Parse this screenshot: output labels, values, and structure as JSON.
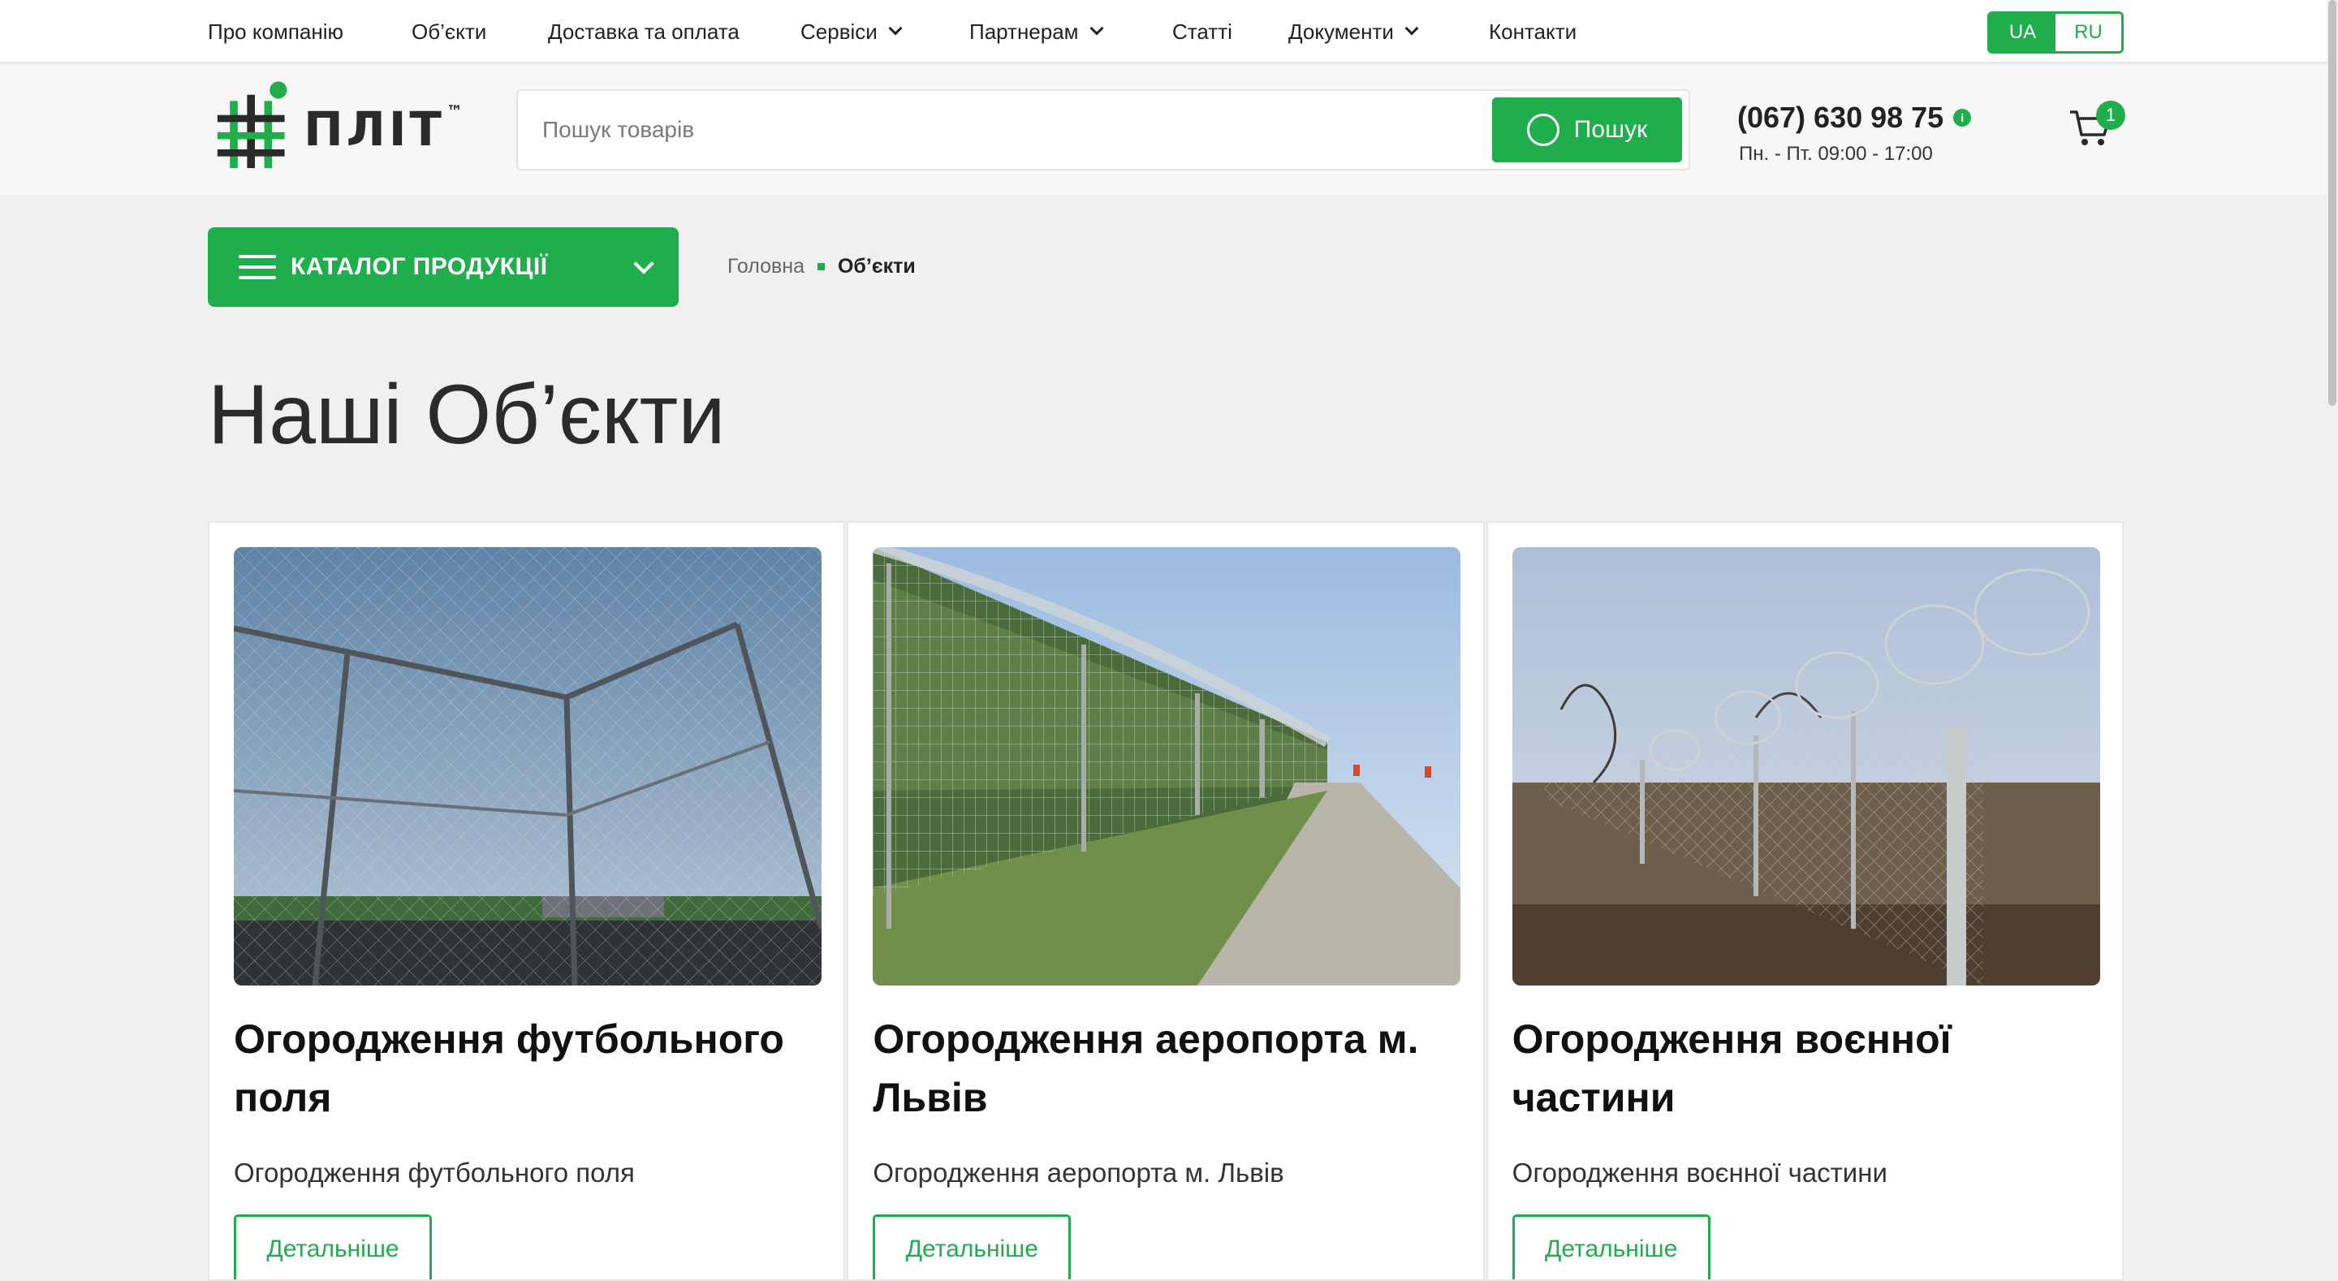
{
  "nav": {
    "items": [
      {
        "label": "Про компанію",
        "dropdown": false
      },
      {
        "label": "Об’єкти",
        "dropdown": false
      },
      {
        "label": "Доставка та оплата",
        "dropdown": false
      },
      {
        "label": "Сервіси",
        "dropdown": true
      },
      {
        "label": "Партнерам",
        "dropdown": true
      },
      {
        "label": "Статті",
        "dropdown": false
      },
      {
        "label": "Документи",
        "dropdown": true
      },
      {
        "label": "Контакти",
        "dropdown": false
      }
    ],
    "lang": {
      "active": "UA",
      "inactive": "RU"
    }
  },
  "header": {
    "logo_text": "ПЛІТ",
    "logo_tm": "™",
    "search_placeholder": "Пошук товарів",
    "search_button": "Пошук",
    "phone": "(067) 630 98 75",
    "phone_info_icon": "i",
    "hours": "Пн. - Пт. 09:00 - 17:00",
    "cart_count": "1"
  },
  "catalog": {
    "label": "КАТАЛОГ ПРОДУКЦІЇ"
  },
  "breadcrumb": {
    "home": "Головна",
    "current": "Об’єкти"
  },
  "page": {
    "title": "Наші Об’єкти"
  },
  "cards": [
    {
      "title": "Огородження футбольного поля",
      "description": "Огородження футбольного поля",
      "button": "Детальніше"
    },
    {
      "title": "Огородження аеропорта м. Львів",
      "description": "Огородження аеропорта м. Львів",
      "button": "Детальніше"
    },
    {
      "title": "Огородження воєнної частини",
      "description": "Огородження воєнної частини",
      "button": "Детальніше"
    }
  ],
  "colors": {
    "accent": "#1fae4b",
    "background": "#f0f0f0",
    "text": "#222222"
  }
}
